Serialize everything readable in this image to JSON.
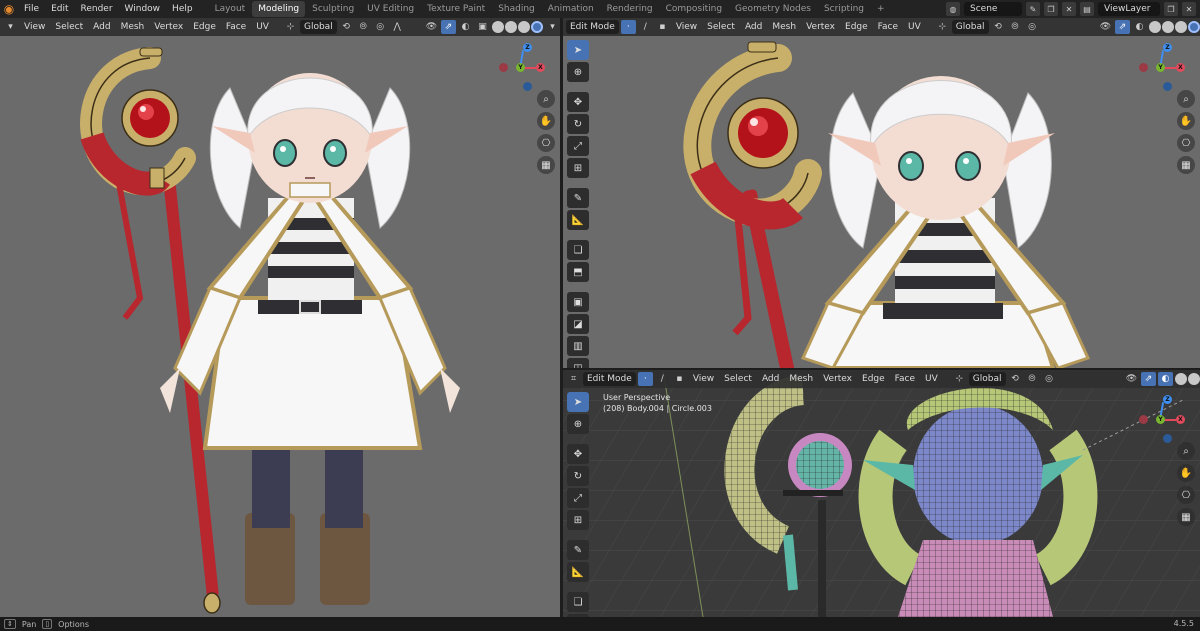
{
  "menu": [
    "File",
    "Edit",
    "Render",
    "Window",
    "Help"
  ],
  "workspaces": [
    {
      "label": "Layout",
      "active": false
    },
    {
      "label": "Modeling",
      "active": true
    },
    {
      "label": "Sculpting",
      "active": false
    },
    {
      "label": "UV Editing",
      "active": false
    },
    {
      "label": "Texture Paint",
      "active": false
    },
    {
      "label": "Shading",
      "active": false
    },
    {
      "label": "Animation",
      "active": false
    },
    {
      "label": "Rendering",
      "active": false
    },
    {
      "label": "Compositing",
      "active": false
    },
    {
      "label": "Geometry Nodes",
      "active": false
    },
    {
      "label": "Scripting",
      "active": false
    }
  ],
  "add_workspace": "+",
  "scene": "Scene",
  "view_layer": "ViewLayer",
  "viewports": {
    "left": {
      "menus": [
        "View",
        "Select",
        "Add",
        "Mesh",
        "Vertex",
        "Edge",
        "Face",
        "UV"
      ],
      "orientation": "Global"
    },
    "top_right": {
      "mode": "Edit Mode",
      "menus": [
        "View",
        "Select",
        "Add",
        "Mesh",
        "Vertex",
        "Edge",
        "Face",
        "UV"
      ],
      "orientation": "Global"
    },
    "bottom_right": {
      "mode": "Edit Mode",
      "menus": [
        "View",
        "Select",
        "Add",
        "Mesh",
        "Vertex",
        "Edge",
        "Face",
        "UV"
      ],
      "orientation": "Global",
      "perspective_label": "User Perspective",
      "object_label": "(208) Body.004 | Circle.003"
    }
  },
  "gizmo": {
    "z": "Z",
    "y": "Y",
    "x": "X",
    "x_color": "#e04a5a",
    "y_color": "#78b530",
    "z_color": "#3f8ff0"
  },
  "status": {
    "pan": "Pan",
    "options": "Options",
    "version": "4.5.5"
  },
  "colors": {
    "accent": "#4772b3",
    "viewport_bg": "#6b6b6b",
    "viewport_dark": "#3a3a3a"
  }
}
